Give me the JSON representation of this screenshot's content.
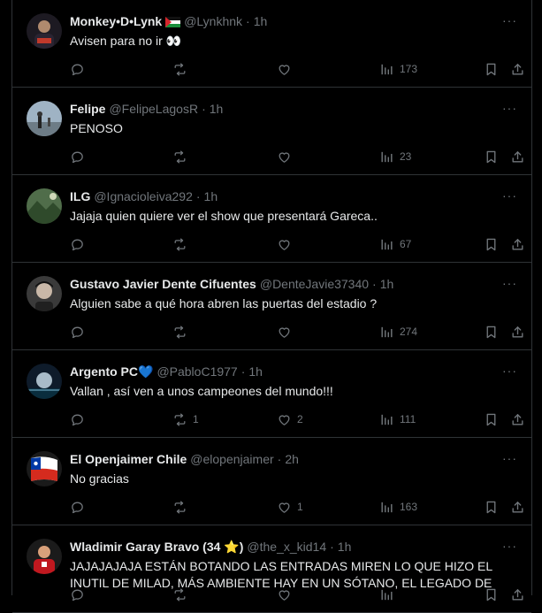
{
  "tweets": [
    {
      "name": "Monkey•D•Lynk",
      "flag": "palestine-flag",
      "handle": "@Lynkhnk",
      "time": "1h",
      "text": "Avisen para no ir 👀",
      "replies": "",
      "retweets": "",
      "likes": "",
      "views": "173"
    },
    {
      "name": "Felipe",
      "flag": "",
      "handle": "@FelipeLagosR",
      "time": "1h",
      "text": "PENOSO",
      "replies": "",
      "retweets": "",
      "likes": "",
      "views": "23"
    },
    {
      "name": "ILG",
      "flag": "",
      "handle": "@Ignacioleiva292",
      "time": "1h",
      "text": "Jajaja quien quiere ver el show que presentará Gareca..",
      "replies": "",
      "retweets": "",
      "likes": "",
      "views": "67"
    },
    {
      "name": "Gustavo Javier Dente Cifuentes",
      "flag": "",
      "handle": "@DenteJavie37340",
      "time": "1h",
      "text": "Alguien sabe a qué hora abren las puertas del estadio ?",
      "replies": "",
      "retweets": "",
      "likes": "",
      "views": "274"
    },
    {
      "name": "Argento PC💙",
      "flag": "",
      "handle": "@PabloC1977",
      "time": "1h",
      "text": "Vallan , así ven a unos campeones del mundo!!!",
      "replies": "",
      "retweets": "1",
      "likes": "2",
      "views": "111"
    },
    {
      "name": "El Openjaimer Chile",
      "flag": "",
      "handle": "@elopenjaimer",
      "time": "2h",
      "text": "No gracias",
      "replies": "",
      "retweets": "",
      "likes": "1",
      "views": "163"
    },
    {
      "name": "Wladimir Garay Bravo (34 ⭐)",
      "flag": "",
      "handle": "@the_x_kid14",
      "time": "1h",
      "text": "JAJAJAJAJA ESTÁN BOTANDO LAS ENTRADAS MIREN LO QUE HIZO EL INUTIL DE MILAD, MÁS AMBIENTE HAY EN UN SÓTANO, EL LEGADO DE",
      "replies": "",
      "retweets": "",
      "likes": "",
      "views": ""
    }
  ],
  "more_label": "···",
  "separator": "·",
  "icons": {
    "reply": "reply-icon",
    "retweet": "retweet-icon",
    "like": "heart-icon",
    "views": "views-icon",
    "bookmark": "bookmark-icon",
    "share": "share-icon"
  },
  "colors": {
    "background": "#000000",
    "text": "#e7e9ea",
    "muted": "#71767b",
    "border": "#2f3336"
  }
}
